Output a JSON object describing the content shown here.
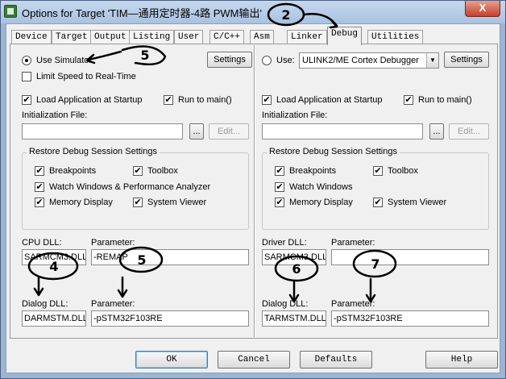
{
  "window": {
    "title": "Options for Target 'TIM—通用定时器-4路 PWM输出'",
    "close_label": "X"
  },
  "tabs": [
    "Device",
    "Target",
    "Output",
    "Listing",
    "User",
    "C/C++",
    "Asm",
    "Linker",
    "Debug",
    "Utilities"
  ],
  "active_tab": "Debug",
  "left": {
    "use_simulator": "Use Simulator",
    "settings": "Settings",
    "limit_speed": "Limit Speed to Real-Time",
    "load_app": "Load Application at Startup",
    "run_to_main": "Run to main()",
    "init_file": "Initialization File:",
    "browse": "...",
    "edit": "Edit...",
    "restore_title": "Restore Debug Session Settings",
    "breakpoints": "Breakpoints",
    "toolbox": "Toolbox",
    "watch_windows": "Watch Windows & Performance Analyzer",
    "memory_display": "Memory Display",
    "system_viewer": "System Viewer",
    "cpu_dll_label": "CPU DLL:",
    "cpu_dll_value": "SARMCM3.DLL",
    "param_label": "Parameter:",
    "cpu_param_value": "-REMAP",
    "dialog_dll_label": "Dialog DLL:",
    "dialog_dll_value": "DARMSTM.DLL",
    "dialog_param_value": "-pSTM32F103RE"
  },
  "right": {
    "use": "Use:",
    "debugger": "ULINK2/ME Cortex Debugger",
    "settings": "Settings",
    "load_app": "Load Application at Startup",
    "run_to_main": "Run to main()",
    "init_file": "Initialization File:",
    "browse": "...",
    "edit": "Edit...",
    "restore_title": "Restore Debug Session Settings",
    "breakpoints": "Breakpoints",
    "toolbox": "Toolbox",
    "watch_windows": "Watch Windows",
    "memory_display": "Memory Display",
    "system_viewer": "System Viewer",
    "driver_dll_label": "Driver DLL:",
    "driver_dll_value": "SARMCM3.DLL",
    "param_label": "Parameter:",
    "driver_param_value": "",
    "dialog_dll_label": "Dialog DLL:",
    "dialog_dll_value": "TARMSTM.DLL",
    "dialog_param_value": "-pSTM32F103RE"
  },
  "buttons": {
    "ok": "OK",
    "cancel": "Cancel",
    "defaults": "Defaults",
    "help": "Help"
  },
  "annotations": [
    "2",
    "5",
    "4",
    "5",
    "6",
    "7"
  ],
  "check_mark": "✔"
}
